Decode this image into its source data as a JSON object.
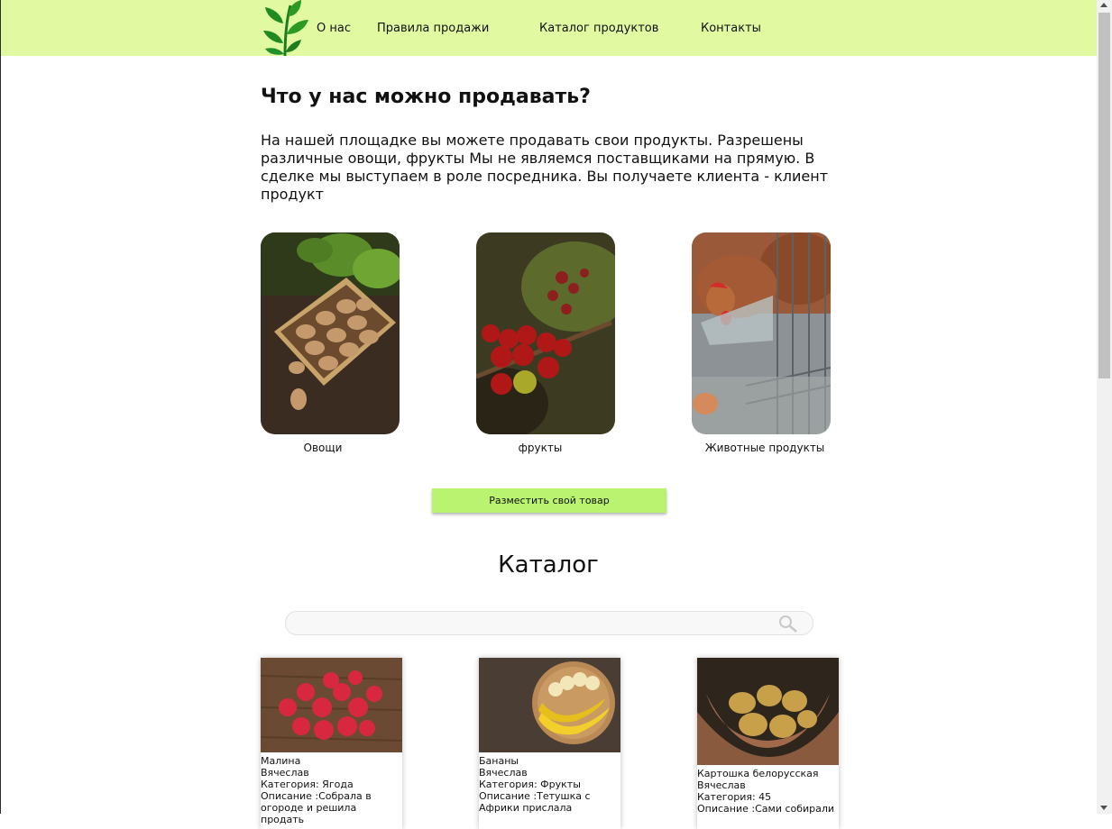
{
  "nav": {
    "items": [
      "О нас",
      "Правила продажи",
      "Каталог продуктов",
      "Контакты"
    ]
  },
  "intro": {
    "title": "Что у нас можно продавать?",
    "text": "На нашей площадке вы можете продавать свои продукты. Разрешены различные овощи, фрукты Мы не являемся поставщиками на прямую. В сделке мы выступаем в роле посредника. Вы получаете клиента - клиент продукт"
  },
  "categories": [
    {
      "label": "Овощи",
      "image": "potatoes-in-crate"
    },
    {
      "label": "фрукты",
      "image": "coffee-berries"
    },
    {
      "label": "Животные продукты",
      "image": "hen-and-egg"
    }
  ],
  "place_button": "Разместить свой товар",
  "catalog": {
    "title": "Каталог",
    "search_placeholder": "",
    "products": [
      {
        "name": "Малина",
        "seller": "Вячеслав",
        "category": "Категория: Ягода",
        "description": "Описание :Собрала в огороде и решила продать",
        "image": "raspberries"
      },
      {
        "name": "Бананы",
        "seller": "Вячеслав",
        "category": "Категория: Фрукты",
        "description": "Описание :Тетушка с Африки прислала",
        "image": "bananas"
      },
      {
        "name": "Картошка белорусская",
        "seller": "Вячеслав",
        "category": "Категория: 45",
        "description": "Описание :Сами собирали",
        "image": "potatoes-in-hands"
      }
    ]
  },
  "colors": {
    "header": "#e1f9a1",
    "button": "#b9f36f",
    "leaf": "#1f8a1f"
  }
}
